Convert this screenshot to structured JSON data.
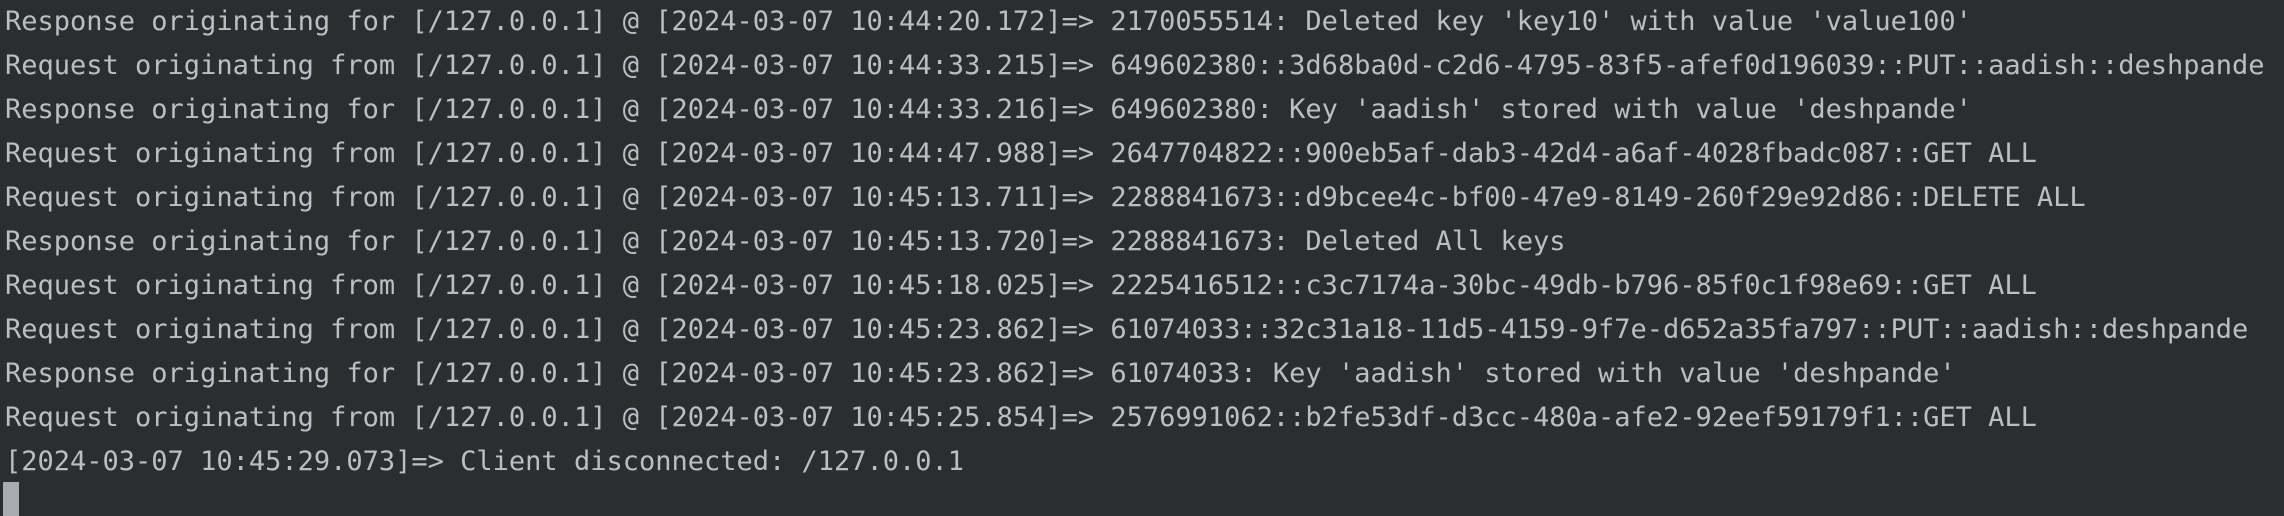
{
  "console": {
    "lines": [
      "Response originating for [/127.0.0.1] @ [2024-03-07 10:44:20.172]=> 2170055514: Deleted key 'key10' with value 'value100'",
      "Request originating from [/127.0.0.1] @ [2024-03-07 10:44:33.215]=> 649602380::3d68ba0d-c2d6-4795-83f5-afef0d196039::PUT::aadish::deshpande",
      "Response originating for [/127.0.0.1] @ [2024-03-07 10:44:33.216]=> 649602380: Key 'aadish' stored with value 'deshpande'",
      "Request originating from [/127.0.0.1] @ [2024-03-07 10:44:47.988]=> 2647704822::900eb5af-dab3-42d4-a6af-4028fbadc087::GET ALL",
      "Request originating from [/127.0.0.1] @ [2024-03-07 10:45:13.711]=> 2288841673::d9bcee4c-bf00-47e9-8149-260f29e92d86::DELETE ALL",
      "Response originating for [/127.0.0.1] @ [2024-03-07 10:45:13.720]=> 2288841673: Deleted All keys",
      "Request originating from [/127.0.0.1] @ [2024-03-07 10:45:18.025]=> 2225416512::c3c7174a-30bc-49db-b796-85f0c1f98e69::GET ALL",
      "Request originating from [/127.0.0.1] @ [2024-03-07 10:45:23.862]=> 61074033::32c31a18-11d5-4159-9f7e-d652a35fa797::PUT::aadish::deshpande",
      "Response originating for [/127.0.0.1] @ [2024-03-07 10:45:23.862]=> 61074033: Key 'aadish' stored with value 'deshpande'",
      "Request originating from [/127.0.0.1] @ [2024-03-07 10:45:25.854]=> 2576991062::b2fe53df-d3cc-480a-afe2-92eef59179f1::GET ALL",
      "[2024-03-07 10:45:29.073]=> Client disconnected: /127.0.0.1"
    ]
  },
  "colors": {
    "background": "#2b2d30",
    "text": "#bcbec4",
    "cursor": "#a9abb0"
  }
}
